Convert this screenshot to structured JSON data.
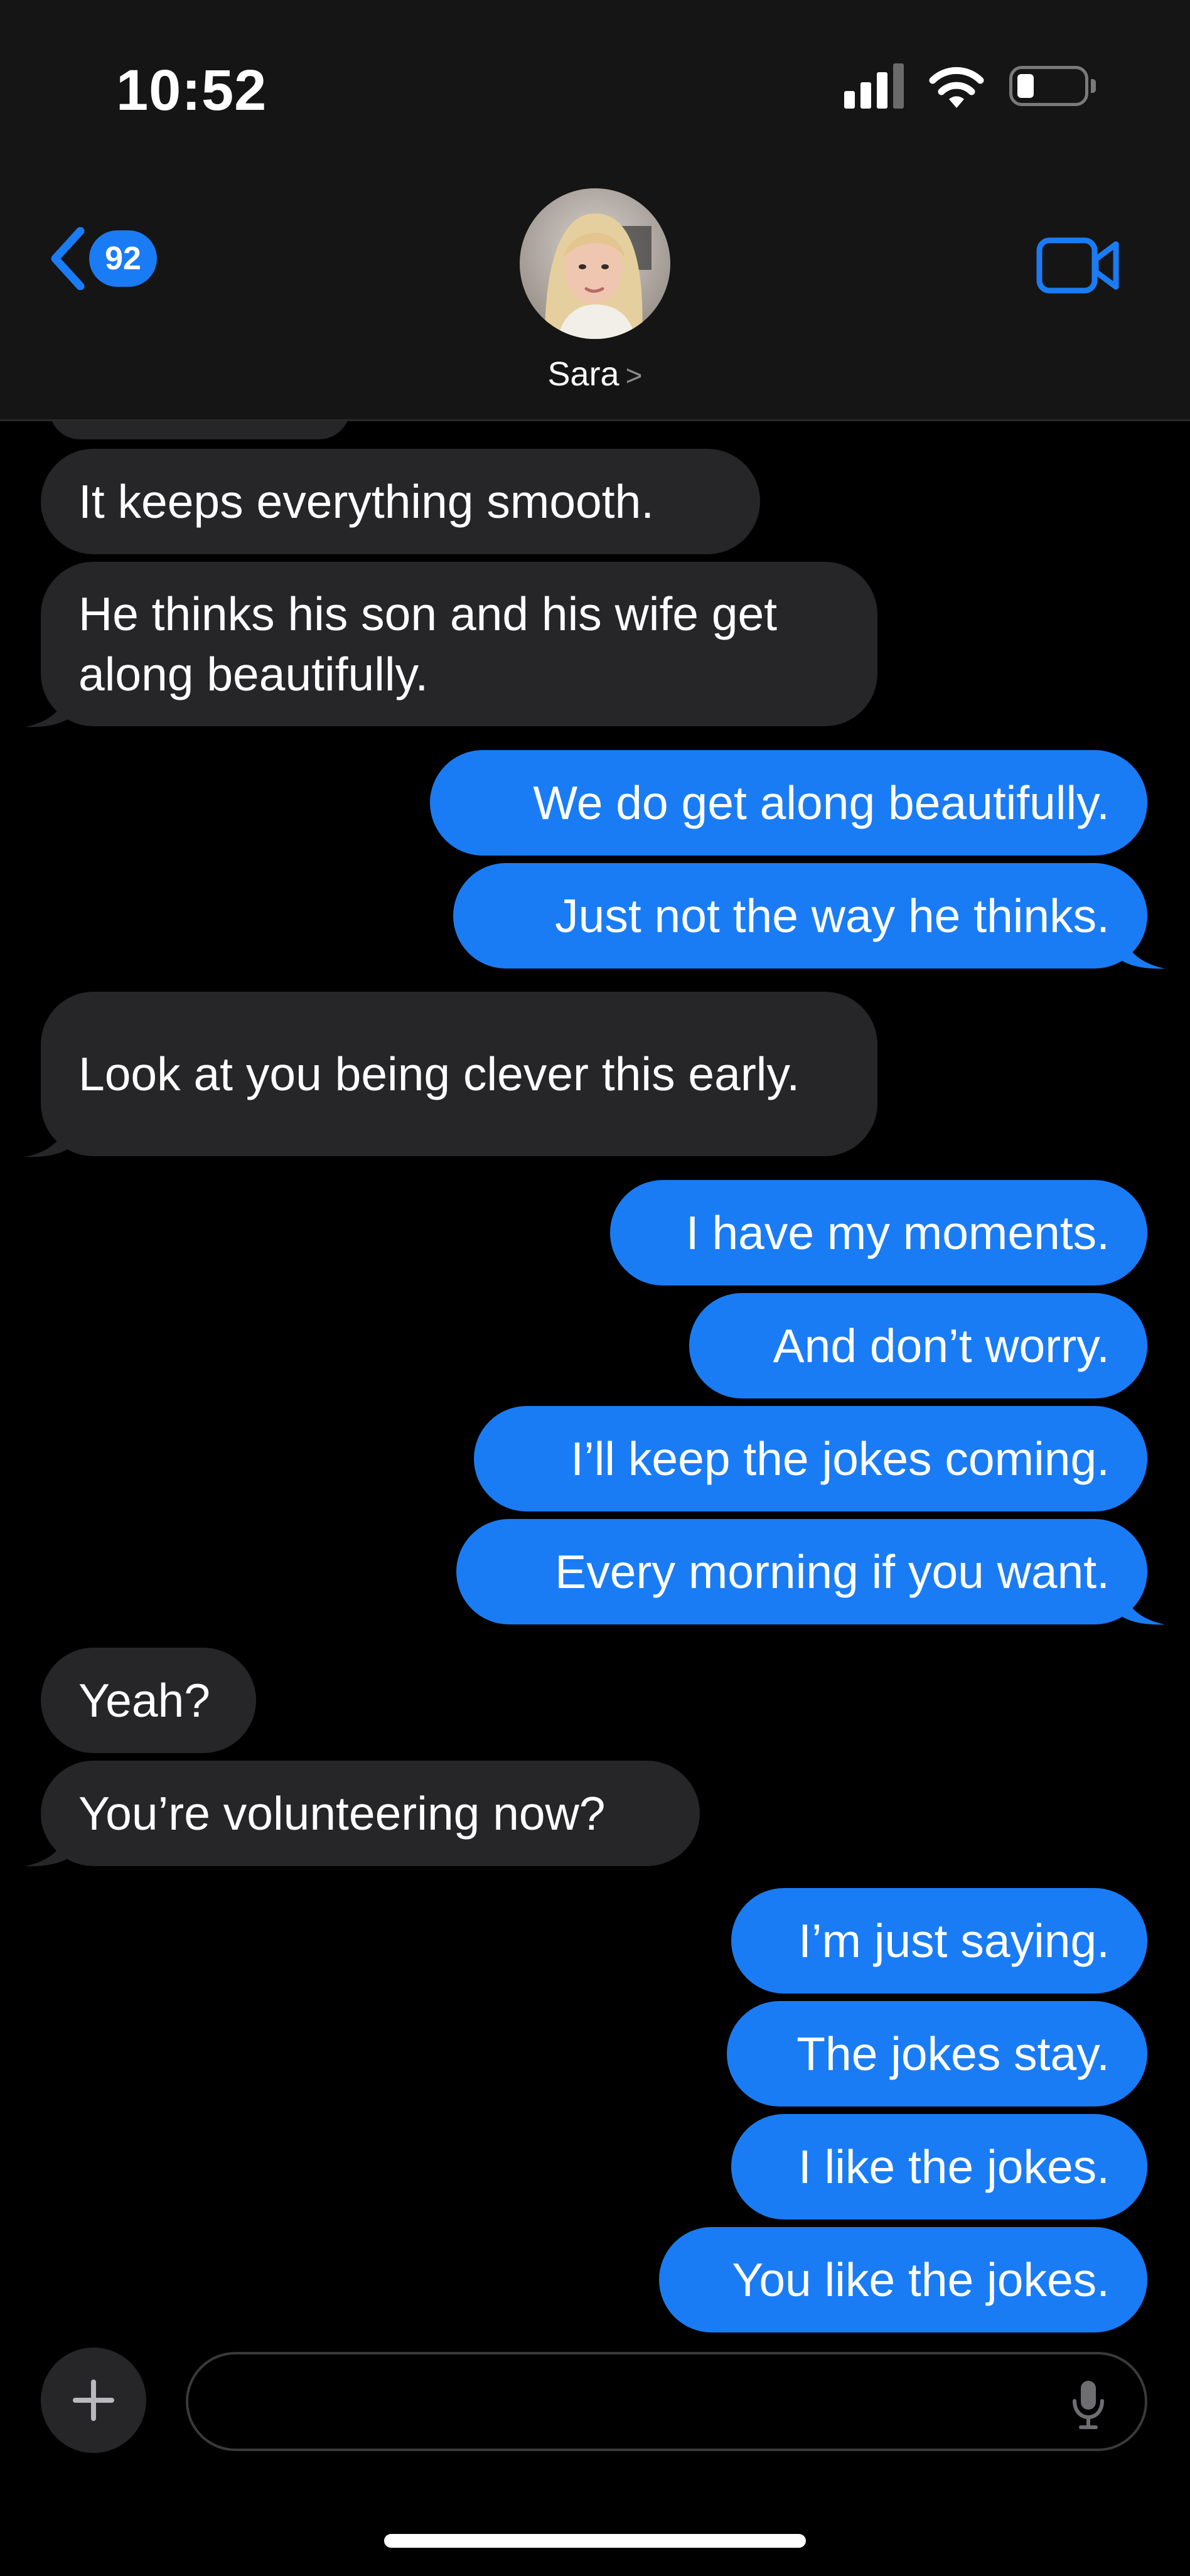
{
  "status_bar": {
    "time": "10:52"
  },
  "header": {
    "back_badge_count": "92",
    "contact_name": "Sara",
    "contact_chevron": ">"
  },
  "messages": [
    {
      "direction": "incoming",
      "text": "It keeps everything smooth."
    },
    {
      "direction": "incoming",
      "text": "He thinks his son and his wife get along beautifully."
    },
    {
      "direction": "outgoing",
      "text": "We do get along beautifully."
    },
    {
      "direction": "outgoing",
      "text": "Just not the way he thinks."
    },
    {
      "direction": "incoming",
      "text": "Look at you being clever this early."
    },
    {
      "direction": "outgoing",
      "text": "I have my moments."
    },
    {
      "direction": "outgoing",
      "text": "And don’t worry."
    },
    {
      "direction": "outgoing",
      "text": "I’ll keep the jokes coming."
    },
    {
      "direction": "outgoing",
      "text": "Every morning if you want."
    },
    {
      "direction": "incoming",
      "text": "Yeah?"
    },
    {
      "direction": "incoming",
      "text": "You’re volunteering now?"
    },
    {
      "direction": "outgoing",
      "text": "I’m just saying."
    },
    {
      "direction": "outgoing",
      "text": "The jokes stay."
    },
    {
      "direction": "outgoing",
      "text": "I like the jokes."
    },
    {
      "direction": "outgoing",
      "text": "You like the jokes."
    }
  ],
  "composer": {
    "placeholder": ""
  },
  "colors": {
    "outgoing_bubble": "#1a7cf5",
    "incoming_bubble": "#262628",
    "background": "#000000",
    "header_background": "#151515",
    "accent": "#1a7cf5"
  },
  "icons": [
    "back-chevron-icon",
    "video-camera-icon",
    "plus-icon",
    "microphone-icon",
    "wifi-icon",
    "signal-icon",
    "battery-icon"
  ]
}
